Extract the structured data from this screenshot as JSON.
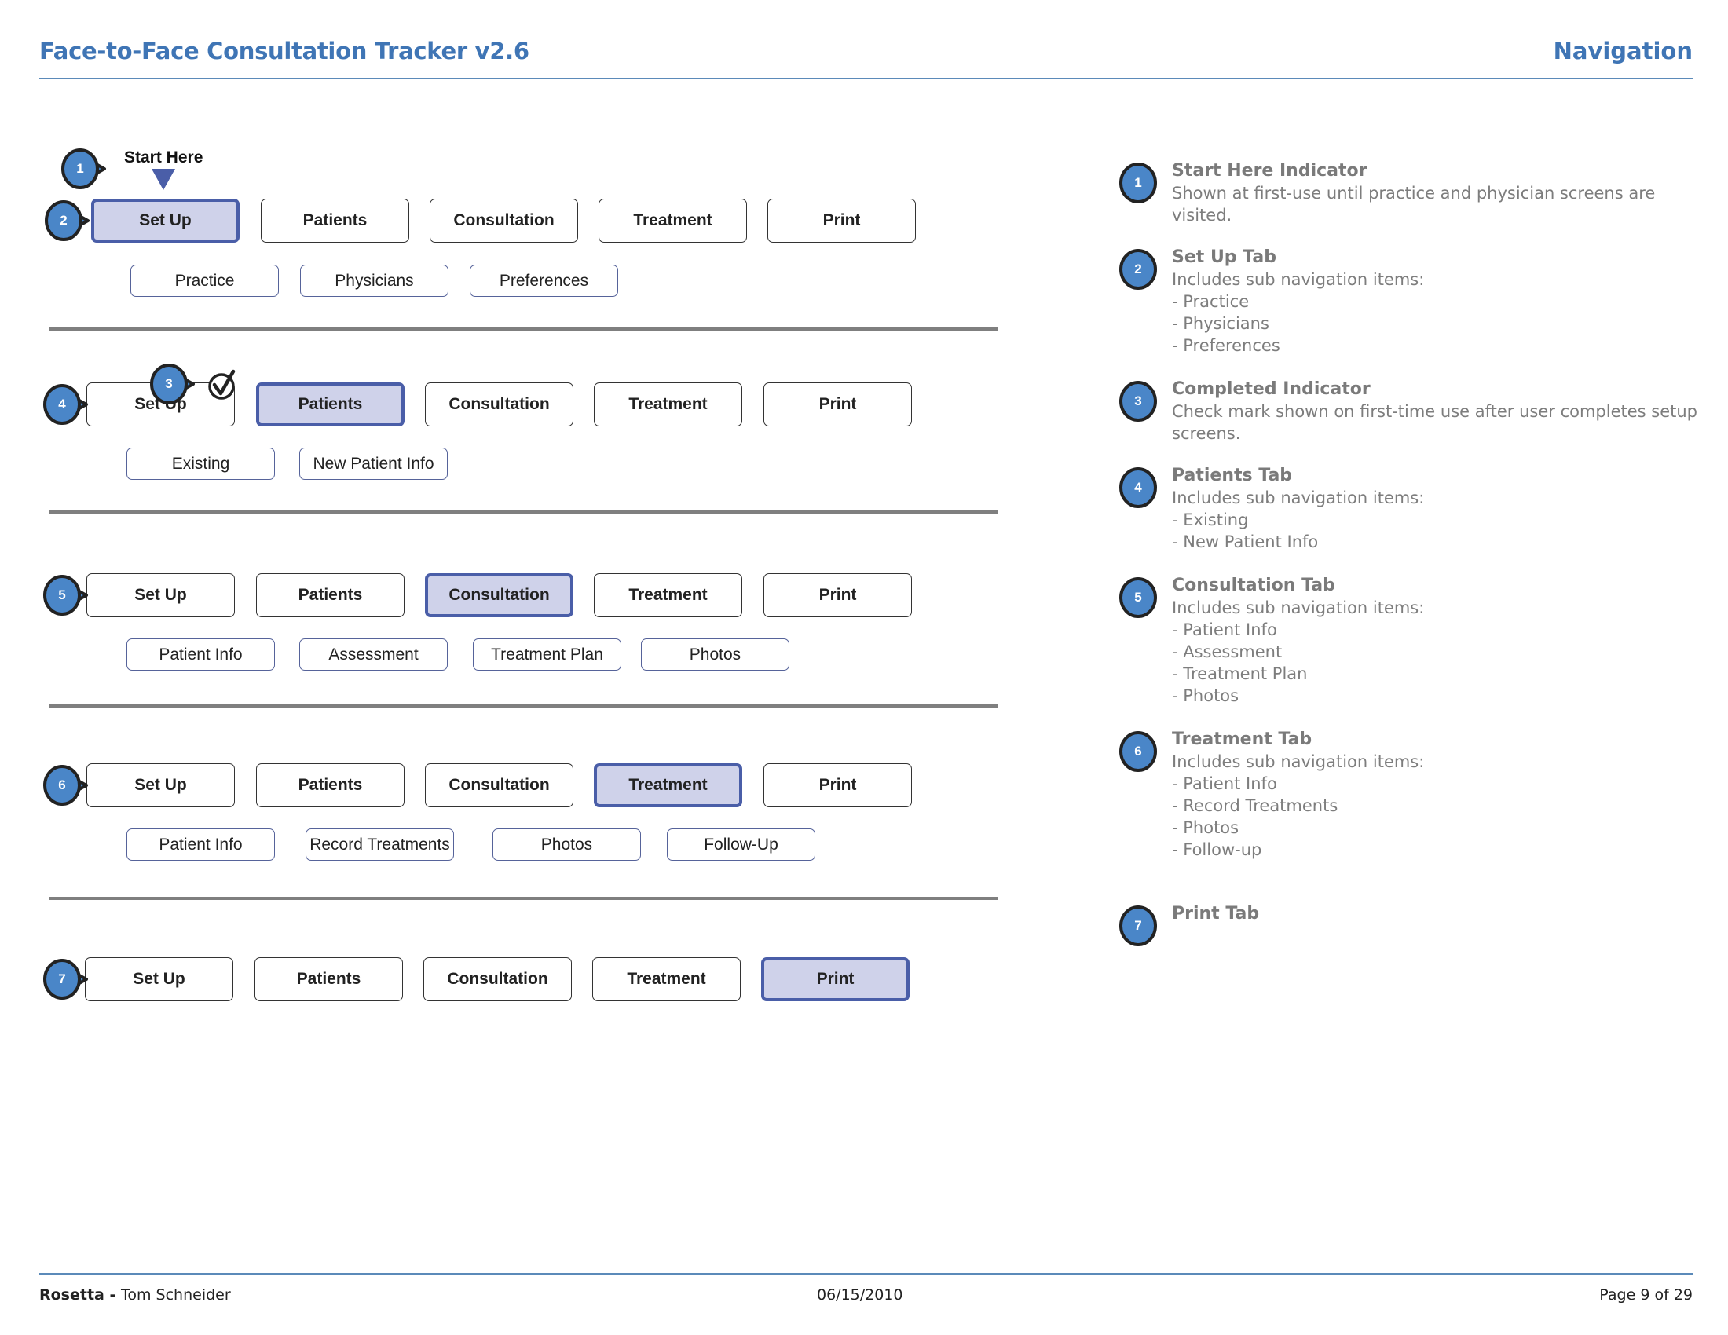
{
  "header": {
    "title": "Face-to-Face Consultation Tracker v2.6",
    "section": "Navigation"
  },
  "colors": {
    "brand_blue": "#3f75b5",
    "active_tab_fill": "#cfd2ea",
    "active_tab_border": "#4a5ea8",
    "badge_fill": "#4a86c8",
    "description_text": "#7d7d7d"
  },
  "start_here": {
    "label": "Start Here",
    "marker": "down-triangle"
  },
  "completed_indicator": {
    "icon": "check-circle-icon"
  },
  "rows": [
    {
      "badge": "2",
      "tabs": [
        "Set Up",
        "Patients",
        "Consultation",
        "Treatment",
        "Print"
      ],
      "active": "Set Up",
      "sub": [
        "Practice",
        "Physicians",
        "Preferences"
      ]
    },
    {
      "badge": "4",
      "tabs": [
        "Set Up",
        "Patients",
        "Consultation",
        "Treatment",
        "Print"
      ],
      "active": "Patients",
      "sub": [
        "Existing",
        "New Patient Info"
      ]
    },
    {
      "badge": "5",
      "tabs": [
        "Set Up",
        "Patients",
        "Consultation",
        "Treatment",
        "Print"
      ],
      "active": "Consultation",
      "sub": [
        "Patient Info",
        "Assessment",
        "Treatment Plan",
        "Photos"
      ]
    },
    {
      "badge": "6",
      "tabs": [
        "Set Up",
        "Patients",
        "Consultation",
        "Treatment",
        "Print"
      ],
      "active": "Treatment",
      "sub": [
        "Patient Info",
        "Record Treatments",
        "Photos",
        "Follow-Up"
      ]
    },
    {
      "badge": "7",
      "tabs": [
        "Set Up",
        "Patients",
        "Consultation",
        "Treatment",
        "Print"
      ],
      "active": "Print",
      "sub": []
    }
  ],
  "callout_badges": {
    "start_here": "1",
    "completed": "3"
  },
  "descriptions": [
    {
      "num": "1",
      "title": "Start Here Indicator",
      "lines": [
        "Shown at first-use until practice and physician screens are visited."
      ]
    },
    {
      "num": "2",
      "title": "Set Up Tab",
      "lines": [
        "Includes sub navigation items:",
        "- Practice",
        "- Physicians",
        "- Preferences"
      ]
    },
    {
      "num": "3",
      "title": "Completed Indicator",
      "lines": [
        "Check mark shown on first-time use after user completes setup screens."
      ]
    },
    {
      "num": "4",
      "title": "Patients Tab",
      "lines": [
        "Includes sub navigation items:",
        "- Existing",
        "- New Patient Info"
      ]
    },
    {
      "num": "5",
      "title": "Consultation Tab",
      "lines": [
        "Includes sub navigation items:",
        "- Patient Info",
        "- Assessment",
        "- Treatment Plan",
        "- Photos"
      ]
    },
    {
      "num": "6",
      "title": "Treatment Tab",
      "lines": [
        "Includes sub navigation items:",
        "- Patient Info",
        "- Record Treatments",
        "- Photos",
        "- Follow-up"
      ]
    },
    {
      "num": "7",
      "title": "Print Tab",
      "lines": []
    }
  ],
  "footer": {
    "company": "Rosetta",
    "separator": " - ",
    "author": "Tom Schneider",
    "date": "06/15/2010",
    "page": "Page 9 of 29"
  }
}
